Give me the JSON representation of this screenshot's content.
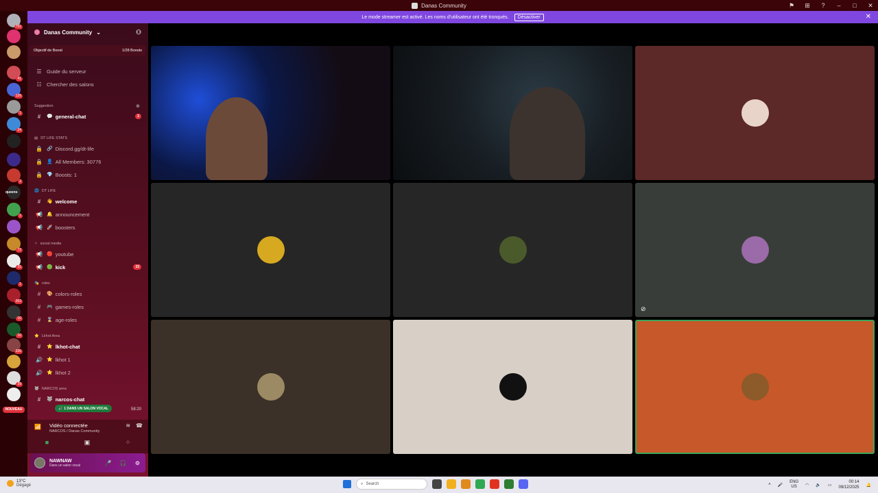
{
  "window": {
    "title": "Danas Community",
    "controls": [
      "⚑",
      "⊞",
      "?",
      "–",
      "□",
      "✕"
    ]
  },
  "banner": {
    "text": "Le mode streamer est activé. Les noms d'utilisateur ont été tronqués.",
    "button": "Désactiver"
  },
  "rail": {
    "servers": [
      {
        "color": "#b0b0b8",
        "badge": "791"
      },
      {
        "color": "#e0326f",
        "badge": ""
      },
      {
        "color": "#c99a6a",
        "badge": ""
      },
      {
        "color": "#d24c55",
        "badge": "41"
      },
      {
        "color": "#4a66d6",
        "badge": "126"
      },
      {
        "color": "#9a9a9a",
        "badge": "1"
      },
      {
        "color": "#3f8ad8",
        "badge": "34"
      },
      {
        "color": "#222222",
        "badge": ""
      },
      {
        "color": "#3b2a8a",
        "badge": ""
      },
      {
        "color": "#c63a2f",
        "badge": "2"
      },
      {
        "color": "#2a2a2a",
        "badge": ""
      },
      {
        "color": "#42a14e",
        "badge": "1"
      },
      {
        "color": "#9b55c9",
        "badge": ""
      },
      {
        "color": "#c78a2a",
        "badge": "72"
      },
      {
        "color": "#eaeaea",
        "badge": "31"
      },
      {
        "color": "#1e2a6a",
        "badge": "1"
      },
      {
        "color": "#a8202b",
        "badge": "263"
      },
      {
        "color": "#333333",
        "badge": "10"
      },
      {
        "color": "#1a5a2a",
        "badge": "10"
      },
      {
        "color": "#884444",
        "badge": "336"
      },
      {
        "color": "#d6a43a",
        "badge": ""
      },
      {
        "color": "#dddddd",
        "badge": "39"
      },
      {
        "color": "#eeeeee",
        "badge": ""
      }
    ],
    "label_queens": "queens",
    "nouveau": "NOUVEAU"
  },
  "sidebar": {
    "server_name": "Danas Community",
    "boost_goal": "Objectif de Boost",
    "boost_count": "1/28 Boosts",
    "guide": "Guide du serveur",
    "browse": "Chercher des salons",
    "categories": {
      "suggestion": "Suggestion",
      "dt_stats": "DT LIFE STATS",
      "dt_life": "DT LIFE",
      "social": "social media",
      "roles": "roles",
      "lkhot": "Lkhot Area",
      "narcos": "NARCOS area"
    },
    "channels": {
      "general": "general-chat",
      "general_badge": "2",
      "discord": "Discord.gg/dt-life",
      "members": "All Members: 30776",
      "boosts": "Boosts: 1",
      "welcome": "welcome",
      "announcement": "announcement",
      "boosters": "boosters",
      "youtube": "youtube",
      "kick": "kick",
      "kick_badge": "33",
      "colors": "colors-roles",
      "games": "games-roles",
      "age": "age-roles",
      "lkhot_chat": "lkhot-chat",
      "lkhot1": "lkhot 1",
      "lkhot2": "lkhot 2",
      "narcos_chat": "narcos-chat"
    },
    "voice_pill": "1 DANS UN SALON VOCAL",
    "voice_time": "58:20",
    "voice": {
      "title": "Vidéo connectée",
      "subtitle": "NARCOS / Danas Community"
    },
    "user": {
      "name": "NAWNAW",
      "status": "Dans un salon vocal"
    }
  },
  "tiles": [
    {
      "kind": "stream1",
      "bg": "#13122a",
      "pfp": ""
    },
    {
      "kind": "stream2",
      "bg": "#151a1e",
      "pfp": ""
    },
    {
      "kind": "avatar",
      "bg": "#5c2828",
      "pfp": "#e9d4c9"
    },
    {
      "kind": "avatar",
      "bg": "#262626",
      "pfp": "#d6a920"
    },
    {
      "kind": "avatar",
      "bg": "#262626",
      "pfp": "#4b5a2a"
    },
    {
      "kind": "avatar",
      "bg": "#393d39",
      "pfp": "#9b6aa8"
    },
    {
      "kind": "avatar",
      "bg": "#3c3128",
      "pfp": "#9c8a64"
    },
    {
      "kind": "avatar",
      "bg": "#d8cfc6",
      "pfp": "#111111"
    },
    {
      "kind": "avatar",
      "bg": "#c75829",
      "pfp": "#8d5a2a"
    }
  ],
  "taskbar": {
    "temp": "13°C",
    "weather": "Dégagé",
    "search": "Search",
    "lang1": "ENG",
    "lang2": "US",
    "time": "00:14",
    "date": "09/12/2025",
    "apps": [
      "#444444",
      "#f2b01e",
      "#e08a1e",
      "#2fa852",
      "#e0321e",
      "#2e7d32",
      "#5865f2"
    ]
  }
}
